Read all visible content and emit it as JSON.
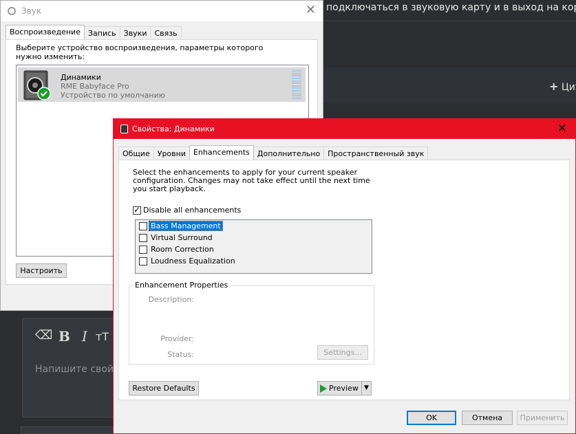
{
  "background": {
    "header_text": "подключаться в звуковую карту и в выход на корпус",
    "reply_label": "Цит",
    "editor_toolbar": {
      "bold": "B",
      "italic": "I",
      "font_size": "тT"
    },
    "editor_placeholder": "Напишите свой с"
  },
  "sound_window": {
    "title": "Звук",
    "close_glyph": "✕",
    "tabs": [
      "Воспроизведение",
      "Запись",
      "Звуки",
      "Связь"
    ],
    "instruction": "Выберите устройство воспроизведения, параметры которого нужно изменить:",
    "device": {
      "name": "Динамики",
      "model": "RME Babyface Pro",
      "status": "Устройство по умолчанию"
    },
    "configure_button": "Настроить"
  },
  "properties_dialog": {
    "title": "Свойства: Динамики",
    "close_glyph": "✕",
    "tabs": [
      "Общие",
      "Уровни",
      "Enhancements",
      "Дополнительно",
      "Пространственный звук"
    ],
    "instruction": "Select the enhancements to apply for your current speaker configuration. Changes may not take effect until the next time you start playback.",
    "disable_all_label": "Disable all enhancements",
    "disable_all_checked": true,
    "enhancements": [
      {
        "label": "Bass Management",
        "checked": false,
        "selected": true
      },
      {
        "label": "Virtual Surround",
        "checked": false,
        "selected": false
      },
      {
        "label": "Room Correction",
        "checked": false,
        "selected": false
      },
      {
        "label": "Loudness Equalization",
        "checked": false,
        "selected": false
      }
    ],
    "properties_group": {
      "title": "Enhancement Properties",
      "description_label": "Description:",
      "provider_label": "Provider:",
      "status_label": "Status:",
      "settings_button": "Settings..."
    },
    "restore_defaults_button": "Restore Defaults",
    "preview_button": "Preview",
    "ok_button": "OK",
    "cancel_button": "Отмена",
    "apply_button": "Применить"
  }
}
